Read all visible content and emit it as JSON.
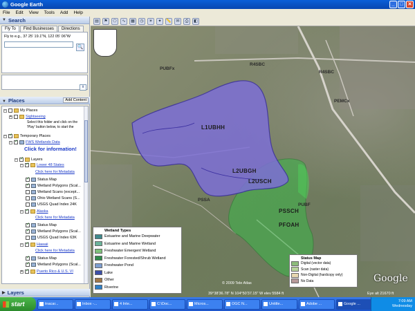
{
  "window": {
    "title": "Google Earth"
  },
  "menu": [
    "File",
    "Edit",
    "View",
    "Tools",
    "Add",
    "Help"
  ],
  "search": {
    "header": "Search",
    "tabs": [
      "Fly To",
      "Find Businesses",
      "Directions"
    ],
    "fly_label": "Fly to e.g., 37 25' 19.1\"N, 122 05' 06\"W",
    "close_label": "x"
  },
  "places": {
    "header": "Places",
    "add_content": "Add Content",
    "my_places": "My Places",
    "sightseeing": "Sightseeing",
    "sightseeing_hint": "Select this folder and click on the 'Play' button below, to start the",
    "temporary": "Temporary Places",
    "fws": "FWS Wetlands Data",
    "click_info": "Click for information!",
    "layers_folder": "Layers",
    "lower48": "Lower 48 States",
    "metadata": "Click here for Metadata",
    "status_map": "Status Map",
    "wetland_polys": "Wetland Polygons (Scal...",
    "wetland_scans": "Wetland Scans (except...",
    "ohio_scans": "Ohio Wetland Scans (S...",
    "usgs24": "USGS Quad Index 24K",
    "alaska": "Alaska",
    "usgs63": "USGS Quad Index 63K",
    "hawaii": "Hawaii",
    "puerto": "Puerto Rico & U.S. VI"
  },
  "layers_panel": {
    "header": "Layers"
  },
  "map": {
    "labels": [
      "L1UBHH",
      "L2UBGH",
      "L2USCH",
      "PSSCH",
      "PFOAH",
      "PSSA"
    ],
    "road_labels": [
      "R4SBC",
      "R4SBC",
      "PUBFx",
      "PUBF",
      "PEMCx"
    ],
    "copyright": "© 2009 Tele Atlas",
    "coords": "39°38'36.78\" N    104°50'37.15\" W     elev  5584 ft",
    "eye_alt": "Eye alt   21670 ft",
    "google": "Google"
  },
  "legend_wetland": {
    "title": "Wetland Types",
    "items": [
      {
        "label": "Estuarine and Marine Deepwater",
        "color": "#3f8a8c"
      },
      {
        "label": "Estuarine and Marine Wetland",
        "color": "#6bb39a"
      },
      {
        "label": "Freshwater Emergent Wetland",
        "color": "#7fc07a"
      },
      {
        "label": "Freshwater Forested/Shrub Wetland",
        "color": "#2f8a4a"
      },
      {
        "label": "Freshwater Pond",
        "color": "#7e9fd0"
      },
      {
        "label": "Lake",
        "color": "#3b4fa8"
      },
      {
        "label": "Other",
        "color": "#a07848"
      },
      {
        "label": "Riverine",
        "color": "#2e80c8"
      }
    ]
  },
  "legend_status": {
    "title": "Status Map",
    "items": [
      {
        "label": "Digital (vector data)",
        "color": "#8dbd7a"
      },
      {
        "label": "Scan (raster data)",
        "color": "#b8d49a"
      },
      {
        "label": "Non-Digital (hardcopy only)",
        "color": "#e8d8b0"
      },
      {
        "label": "No Data",
        "color": "#b89a9a"
      }
    ]
  },
  "taskbar": {
    "start": "start",
    "tasks": [
      "tnacar...",
      "Inbox -...",
      "4 Inte...",
      "C:\\Doc...",
      "Micros...",
      "OGC N...",
      "Untitle...",
      "Adobe ...",
      "Google ..."
    ],
    "time": "7:09 AM",
    "day": "Wednesday"
  }
}
